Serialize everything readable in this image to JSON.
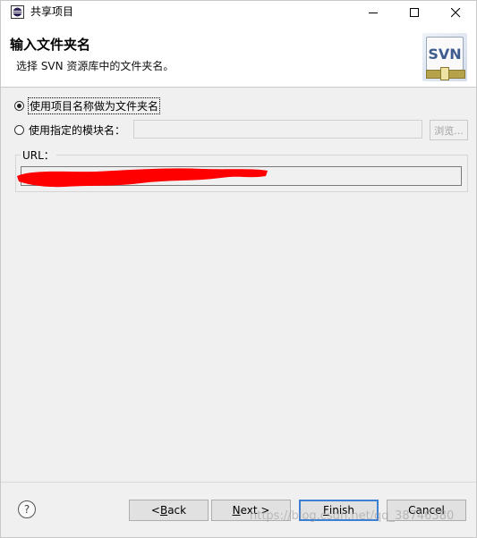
{
  "window": {
    "title": "共享项目",
    "controls": [
      "minimize-icon",
      "maximize-icon",
      "close-icon"
    ]
  },
  "header": {
    "title": "输入文件夹名",
    "description": "选择 SVN 资源库中的文件夹名。",
    "badge_text": "SVN"
  },
  "options": {
    "use_project_name_label": "使用项目名称做为文件夹名",
    "use_project_name_selected": true,
    "use_module_name_label": "使用指定的模块名：",
    "use_module_name_selected": false,
    "module_name_value": "",
    "browse_label": "浏览..."
  },
  "url": {
    "label": "URL：",
    "value": "",
    "redaction_color": "#ff0000"
  },
  "footer": {
    "help_icon": "help-icon",
    "back_label": "< Back",
    "back_mnemonic_prefix": "< ",
    "back_mnemonic_char": "B",
    "back_rest": "ack",
    "next_label": "Next >",
    "next_mnemonic_char": "N",
    "next_rest": "ext >",
    "finish_label": "Finish",
    "finish_mnemonic_char": "F",
    "finish_rest": "inish",
    "cancel_label": "Cancel"
  },
  "watermark": "https://blog.csdn.net/qq_38746380",
  "colors": {
    "accent": "#3c7fd3",
    "background": "#f0f0f0",
    "header_bg": "#ffffff"
  }
}
